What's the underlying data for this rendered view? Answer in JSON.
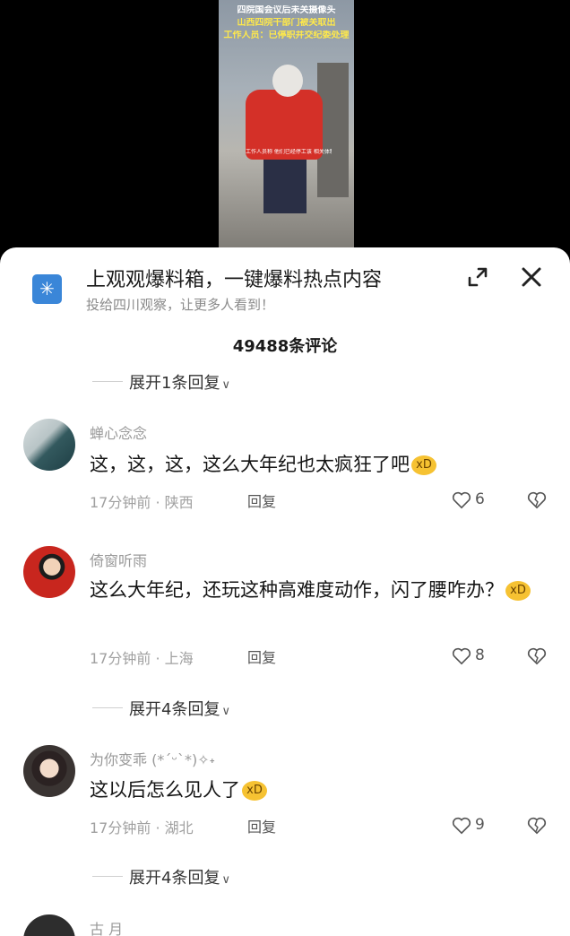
{
  "video": {
    "caption_line1": "四院国会议后未关摄像头",
    "caption_line2": "山西四院干部门被关取出",
    "caption_line3": "工作人员：已停职并交纪委处理",
    "subtitle": "工作人员称 他们已经停工该 相关体制处理 未知流"
  },
  "header": {
    "icon_glyph": "✳",
    "title": "上观观爆料箱，一键爆料热点内容",
    "subtitle": "投给四川观察，让更多人看到！"
  },
  "comments_count": "49488条评论",
  "expand_replies": [
    {
      "label": "展开1条回复"
    },
    {
      "label": "展开4条回复"
    },
    {
      "label": "展开4条回复"
    }
  ],
  "comments": [
    {
      "username": "蝉心念念",
      "text": "这，这，这，这么大年纪也太疯狂了吧",
      "emoji": "xD",
      "time_location": "17分钟前 · 陕西",
      "reply_label": "回复",
      "likes": "6"
    },
    {
      "username": "倚窗听雨",
      "text": "这么大年纪，还玩这种高难度动作，闪了腰咋办？",
      "emoji": "xD",
      "time_location": "17分钟前 · 上海",
      "reply_label": "回复",
      "likes": "8"
    },
    {
      "username": "为你变乖 (*ˊᵕˋ*)✧˖",
      "text": "这以后怎么见人了",
      "emoji": "xD",
      "time_location": "17分钟前 · 湖北",
      "reply_label": "回复",
      "likes": "9"
    },
    {
      "username": "古 月"
    }
  ]
}
